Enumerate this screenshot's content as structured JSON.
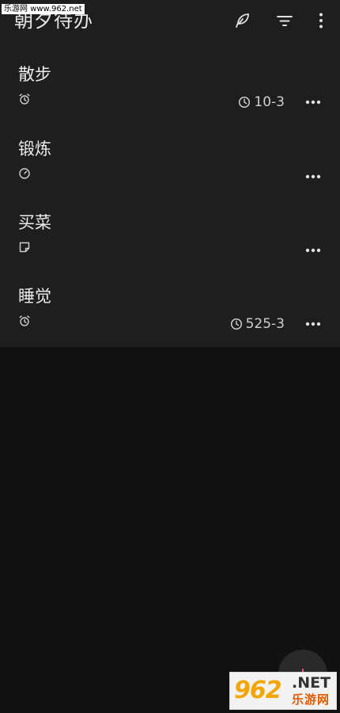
{
  "watermark": {
    "top_left": "乐游网 www.962.net",
    "bottom_right_number": "962",
    "bottom_right_domain": ".NET",
    "bottom_right_cn": "乐游网"
  },
  "header": {
    "title": "朝夕待办",
    "icons": [
      "feather-icon",
      "filter-icon",
      "more-vertical-icon"
    ]
  },
  "todos": [
    {
      "title": "散步",
      "type_icon": "alarm-icon",
      "reminder": "10-3"
    },
    {
      "title": "锻炼",
      "type_icon": "timer-icon",
      "reminder": ""
    },
    {
      "title": "买菜",
      "type_icon": "note-icon",
      "reminder": ""
    },
    {
      "title": "睡觉",
      "type_icon": "alarm-icon",
      "reminder": "525-3"
    }
  ],
  "fab": {
    "icon": "plus-icon"
  },
  "colors": {
    "background": "#121212",
    "panel": "#1e1e1e",
    "text": "#ececec",
    "fab_plus": "#ff4f8b"
  }
}
